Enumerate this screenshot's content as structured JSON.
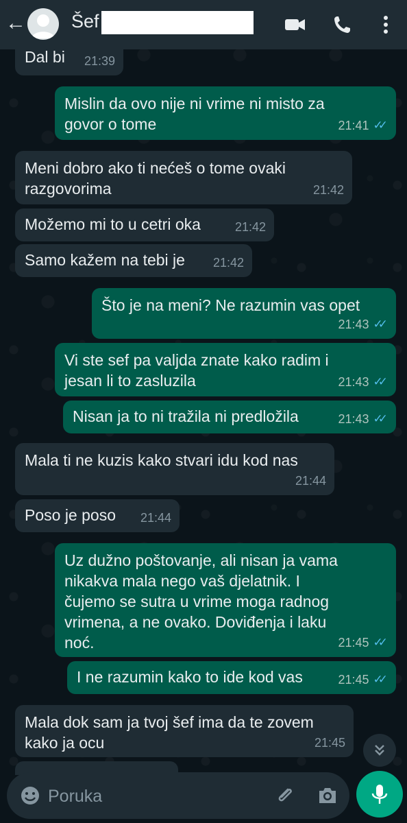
{
  "header": {
    "back_label": "←",
    "contact_name": "Šef"
  },
  "messages": [
    {
      "dir": "in",
      "text": "Dal bi",
      "time": "21:39"
    },
    {
      "dir": "out",
      "text": "Mislin da ovo nije ni vrime ni misto za\ngovor o tome",
      "time": "21:41",
      "read": true
    },
    {
      "dir": "in",
      "text": "Meni dobro ako ti nećeš o tome ovaki\nrazgovorima",
      "time": "21:42"
    },
    {
      "dir": "in",
      "text": "Možemo mi to u cetri oka",
      "time": "21:42"
    },
    {
      "dir": "in",
      "text": "Samo kažem na tebi je",
      "time": "21:42"
    },
    {
      "dir": "out",
      "text": "Što je na meni? Ne razumin vas opet",
      "time": "21:43",
      "read": true
    },
    {
      "dir": "out",
      "text": "Vi ste sef pa valjda znate kako radim i\njesan li to zasluzila",
      "time": "21:43",
      "read": true
    },
    {
      "dir": "out",
      "text": "Nisan ja to ni tražila ni predložila",
      "time": "21:43",
      "read": true
    },
    {
      "dir": "in",
      "text": "Mala ti ne kuzis kako stvari idu kod nas",
      "time": "21:44"
    },
    {
      "dir": "in",
      "text": "Poso je poso",
      "time": "21:44"
    },
    {
      "dir": "out",
      "text": "Uz dužno poštovanje, ali nisan ja vama\nnikakva mala nego vaš djelatnik. I\nčujemo se sutra u vrime moga radnog\nvrimena, a ne ovako. Doviđenja i laku\nnoć.",
      "time": "21:45",
      "read": true
    },
    {
      "dir": "out",
      "text": "I ne razumin kako to ide kod vas",
      "time": "21:45",
      "read": true
    },
    {
      "dir": "in",
      "text": "Mala dok sam ja tvoj šef ima da te zovem\nkako ja ocu",
      "time": "21:45"
    }
  ],
  "input": {
    "placeholder": "Poruka"
  },
  "icons": {
    "back": "arrow-left",
    "avatar": "default-avatar",
    "video": "video-camera",
    "call": "phone",
    "menu": "more-vertical",
    "emoji": "smiley",
    "attach": "paperclip",
    "camera": "camera",
    "mic": "microphone",
    "scroll": "double-chevron-down"
  },
  "colors": {
    "header_bg": "#1f2c34",
    "chat_bg": "#0b141a",
    "incoming_bubble": "#1f2c34",
    "outgoing_bubble": "#005c4b",
    "read_ticks": "#53bdeb",
    "mic_button": "#00a884"
  }
}
